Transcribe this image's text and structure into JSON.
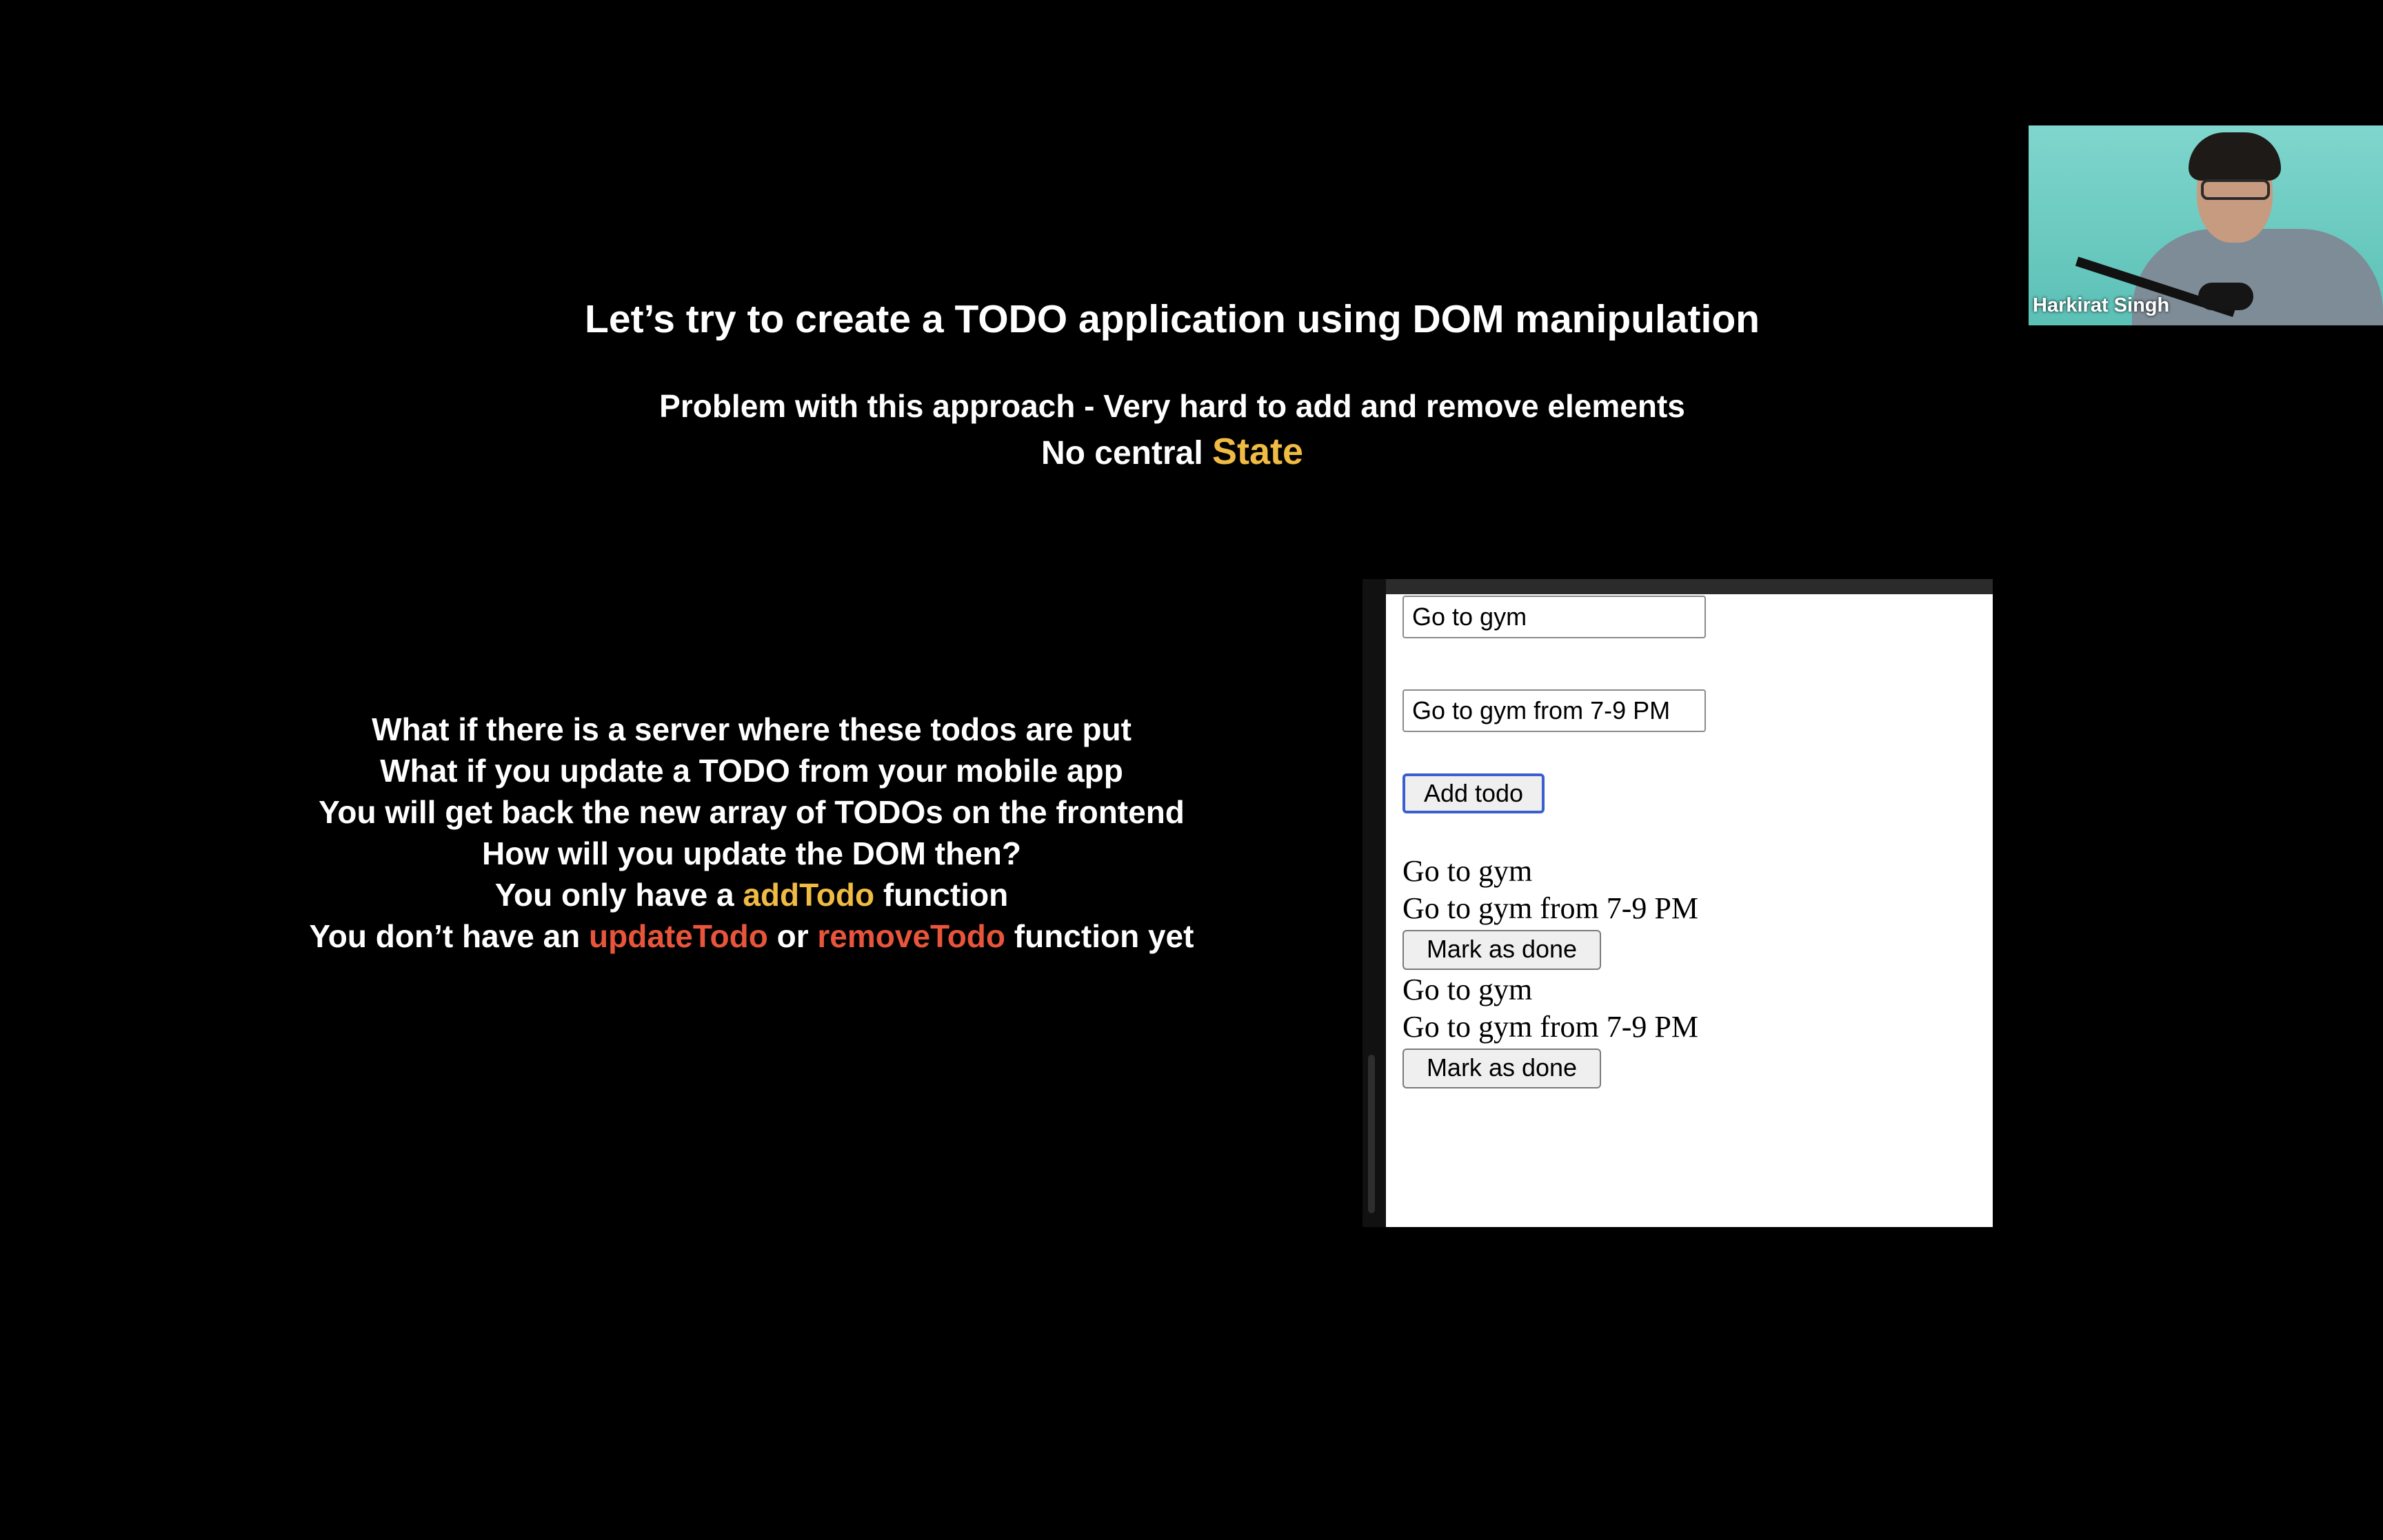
{
  "slide": {
    "title": "Let’s try to create a TODO application using DOM manipulation",
    "problem": "Problem with this approach - Very hard to add and remove elements",
    "no_central": "No central ",
    "state_word": "State",
    "bullets": {
      "line1": "What if there is a server where these todos are put",
      "line2": "What if you update a TODO from your mobile app",
      "line3": "You will get back the new array of TODOs on the frontend",
      "line4": "How will you update the DOM then?",
      "line5_pre": "You only have a ",
      "line5_fn": "addTodo",
      "line5_post": " function",
      "line6_pre": "You don’t have an ",
      "line6_fn1": "updateTodo",
      "line6_mid": " or ",
      "line6_fn2": "removeTodo",
      "line6_post": " function yet"
    }
  },
  "demo": {
    "title_input_value": "Go to gym",
    "description_input_value": "Go to gym from 7-9 PM",
    "add_button_label": "Add todo",
    "todos": [
      {
        "title": "Go to gym",
        "description": "Go to gym from 7-9 PM",
        "button": "Mark as done"
      },
      {
        "title": "Go to gym",
        "description": "Go to gym from 7-9 PM",
        "button": "Mark as done"
      }
    ]
  },
  "video": {
    "participant_name": "Harkirat Singh"
  },
  "colors": {
    "background": "#000000",
    "highlight_yellow": "#f0bb43",
    "highlight_orange": "#e8553b"
  }
}
